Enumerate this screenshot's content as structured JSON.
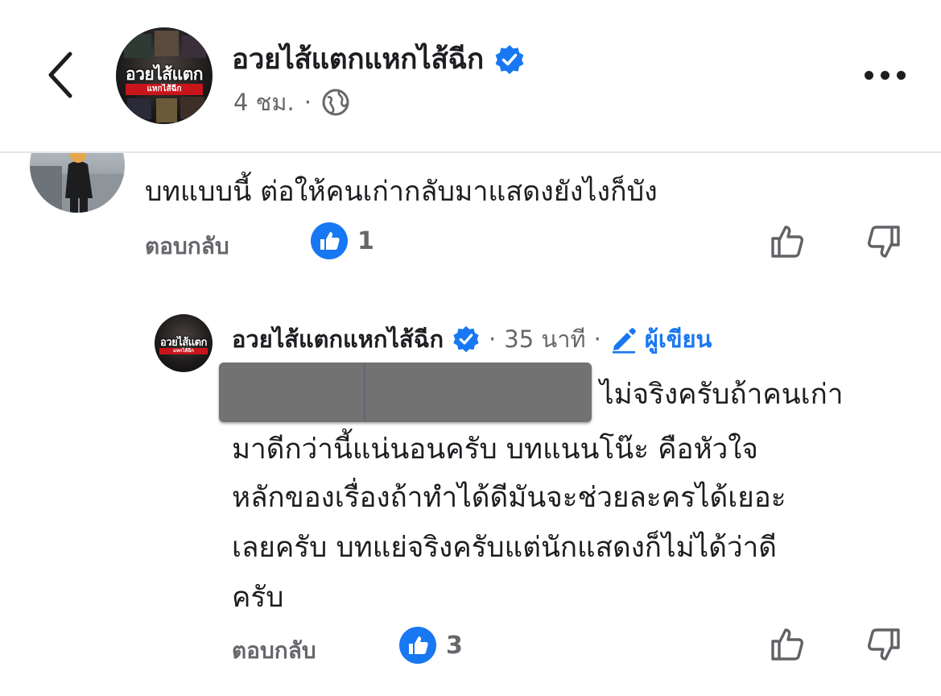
{
  "header": {
    "page_name": "อวยไส้แตกแหกไส้ฉีก",
    "time": "4 ชม.",
    "separator": "·",
    "avatar_title": "อวยไส้แตก",
    "avatar_subtitle": "แหกไส้ฉีก"
  },
  "comment1": {
    "text": "บทแบบนี้ ต่อให้คนเก่ากลับมาแสดงยังไงก็บัง",
    "reply_label": "ตอบกลับ",
    "like_count": "1"
  },
  "reply_comment": {
    "name": "อวยไส้แตกแหกไส้ฉีก",
    "separator": "·",
    "time": "35 นาที",
    "author_label": "ผู้เขียน",
    "lines": [
      "ไม่จริงครับถ้าคนเก่า",
      "มาดีกว่านี้แน่นอนครับ บทแนนโน๊ะ คือหัวใจ",
      "หลักของเรื่องถ้าทำได้ดีมันจะช่วยละครได้เยอะ",
      "เลยครับ บทแย่จริงครับแต่นักแสดงก็ไม่ได้ว่าดี",
      "ครับ"
    ],
    "reply_label": "ตอบกลับ",
    "like_count": "3"
  },
  "colors": {
    "accent": "#1877f2",
    "secondary_text": "#65676b",
    "redaction": "#727272"
  },
  "icons": [
    "back-icon",
    "verified-icon",
    "globe-icon",
    "more-icon",
    "like-icon",
    "dislike-icon",
    "pencil-icon"
  ]
}
